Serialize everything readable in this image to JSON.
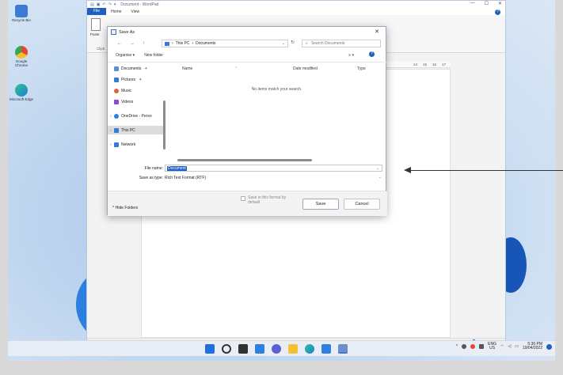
{
  "desktop": {
    "icons": [
      {
        "label": "Recycle Bin",
        "icon": "recycle-bin-icon",
        "color": "#3b7bd4"
      },
      {
        "label": "Google Chrome",
        "icon": "chrome-icon",
        "color": "#e8453c"
      },
      {
        "label": "Microsoft Edge",
        "icon": "edge-icon",
        "color": "#1aa0c8"
      }
    ]
  },
  "wordpad": {
    "title": "Document - WordPad",
    "menu": {
      "file": "File",
      "home": "Home",
      "view": "View",
      "help": "?"
    },
    "ribbon": {
      "paste": "Paste",
      "clipboard": "Clipb"
    },
    "ruler": [
      "14",
      "15",
      "16",
      "17"
    ],
    "zoom": "100%",
    "window_controls": {
      "minimize": "—",
      "maximize": "☐",
      "close": "✕"
    }
  },
  "dialog": {
    "title": "Save As",
    "close": "✕",
    "nav": {
      "back": "←",
      "forward": "→",
      "up": "↑"
    },
    "address": {
      "root": "This PC",
      "sep": "›",
      "folder": "Documents"
    },
    "search_placeholder": "Search Documents",
    "toolbar": {
      "organise": "Organise ▾",
      "new_folder": "New folder",
      "help": "?"
    },
    "nav_pane": [
      {
        "label": "Documents",
        "icon": "documents-icon",
        "color": "#5b8ed6",
        "pin": true
      },
      {
        "label": "Pictures",
        "icon": "pictures-icon",
        "color": "#3c78d8",
        "pin": true
      },
      {
        "label": "Music",
        "icon": "music-icon",
        "color": "#e0633a"
      },
      {
        "label": "Videos",
        "icon": "videos-icon",
        "color": "#8a4bd8"
      },
      {
        "label": "OneDrive - Perso",
        "icon": "onedrive-icon",
        "color": "#2f7fe0"
      },
      {
        "label": "This PC",
        "icon": "this-pc-icon",
        "color": "#3c78d8",
        "selected": true
      },
      {
        "label": "Network",
        "icon": "network-icon",
        "color": "#3c78d8"
      }
    ],
    "columns": {
      "name": "Name",
      "date": "Date modified",
      "type": "Type"
    },
    "empty_message": "No items match your search.",
    "file_name_label": "File name:",
    "file_name_value": "Document",
    "save_as_type_label": "Save as type:",
    "save_as_type_value": "Rich Text Format (RTF)",
    "hide_folders": "^ Hide Folders",
    "default_checkbox": "Save in this format by default",
    "save_button": "Save",
    "cancel_button": "Cancel"
  },
  "taskbar": {
    "apps": [
      {
        "name": "start",
        "icon": "windows-start-icon",
        "color": "#1f6fe0"
      },
      {
        "name": "search",
        "icon": "search-icon",
        "color": "#333333"
      },
      {
        "name": "task-view",
        "icon": "task-view-icon",
        "color": "#333333"
      },
      {
        "name": "widgets",
        "icon": "widgets-icon",
        "color": "#2f7fe0"
      },
      {
        "name": "chat",
        "icon": "chat-icon",
        "color": "#5b5fd6"
      },
      {
        "name": "explorer",
        "icon": "file-explorer-icon",
        "color": "#f2c230"
      },
      {
        "name": "edge",
        "icon": "edge-icon",
        "color": "#1aa0c8"
      },
      {
        "name": "store",
        "icon": "store-icon",
        "color": "#2f7fe0"
      },
      {
        "name": "wordpad",
        "icon": "wordpad-icon",
        "color": "#6e8fc7"
      }
    ],
    "lang": {
      "line1": "ENG",
      "line2": "US"
    },
    "clock": {
      "time": "5:36 PM",
      "date": "19/04/2022"
    }
  }
}
